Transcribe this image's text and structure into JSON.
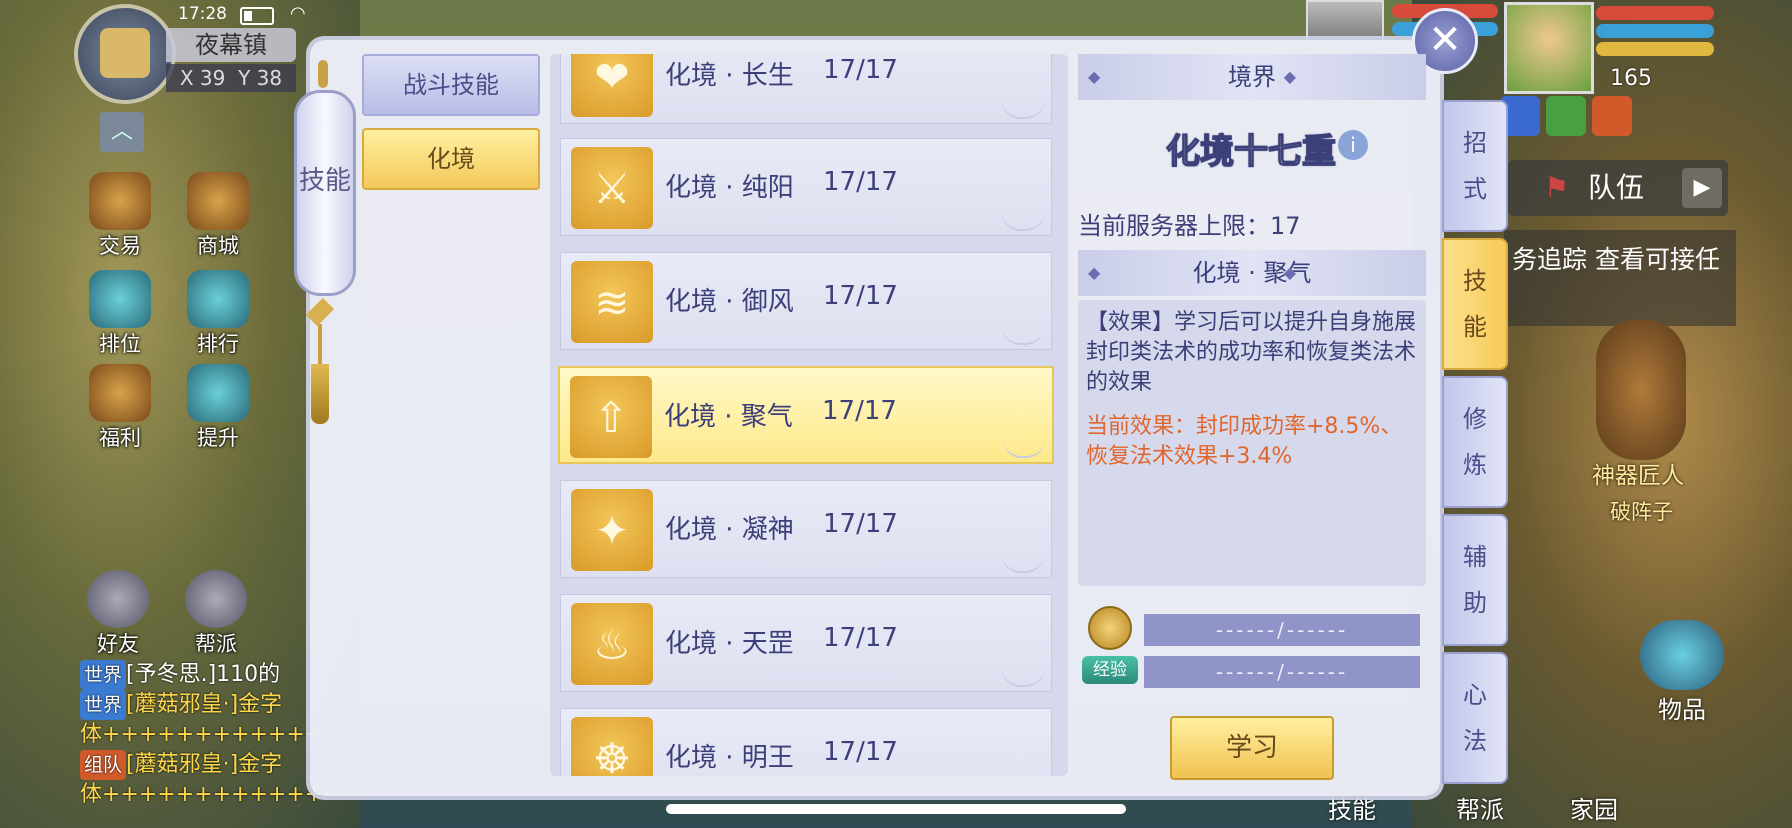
{
  "status": {
    "time": "17:28"
  },
  "map": {
    "town": "夜幕镇",
    "x_label": "X",
    "x": "39",
    "y_label": "Y",
    "y": "38"
  },
  "hud_left": [
    {
      "label": "交易",
      "icon": "trade-icon"
    },
    {
      "label": "商城",
      "icon": "shop-icon"
    },
    {
      "label": "排位",
      "icon": "ranking-icon"
    },
    {
      "label": "排行",
      "icon": "leaderboard-icon"
    },
    {
      "label": "福利",
      "icon": "welfare-icon"
    },
    {
      "label": "提升",
      "icon": "upgrade-icon"
    },
    {
      "label": "好友",
      "icon": "friends-icon"
    },
    {
      "label": "帮派",
      "icon": "guild-icon"
    }
  ],
  "chat": {
    "lines": [
      {
        "tag": "世界",
        "tag_type": "world",
        "text": "[予冬思.]110的"
      },
      {
        "tag": "世界",
        "tag_type": "world",
        "text": "[蘑菇邪皇·]金字"
      },
      {
        "tag": "",
        "tag_type": "",
        "text": "体+++++++++++++++"
      },
      {
        "tag": "组队",
        "tag_type": "team",
        "text": "[蘑菇邪皇·]金字"
      },
      {
        "tag": "",
        "tag_type": "",
        "text": "体+++++++++++++++++[申请入队]"
      }
    ]
  },
  "player": {
    "level": "165"
  },
  "team": {
    "label": "队伍"
  },
  "quest_tip": "务追踪 查看可接任",
  "npc": {
    "name": "神器匠人",
    "title": "破阵子"
  },
  "items": {
    "label": "物品"
  },
  "bottom_menu": [
    "技能",
    "帮派",
    "家园"
  ],
  "panel": {
    "spine_title": "技能",
    "close_label": "✕",
    "side_tabs": [
      {
        "label": "战斗技能",
        "active": false
      },
      {
        "label": "化境",
        "active": true
      }
    ],
    "skills": [
      {
        "name": "化境 · 长生",
        "level": "17/17",
        "icon": "longevity-icon",
        "glyph": "❤",
        "selected": false
      },
      {
        "name": "化境 · 纯阳",
        "level": "17/17",
        "icon": "pure-yang-sword-icon",
        "glyph": "⚔",
        "selected": false
      },
      {
        "name": "化境 · 御风",
        "level": "17/17",
        "icon": "wind-rider-icon",
        "glyph": "≋",
        "selected": false
      },
      {
        "name": "化境 · 聚气",
        "level": "17/17",
        "icon": "gather-qi-icon",
        "glyph": "⇧",
        "selected": true
      },
      {
        "name": "化境 · 凝神",
        "level": "17/17",
        "icon": "focus-spirit-icon",
        "glyph": "✦",
        "selected": false
      },
      {
        "name": "化境 · 天罡",
        "level": "17/17",
        "icon": "heavenly-flame-icon",
        "glyph": "♨",
        "selected": false
      },
      {
        "name": "化境 · 明王",
        "level": "17/17",
        "icon": "wisdom-king-icon",
        "glyph": "☸",
        "selected": false
      }
    ],
    "realm": {
      "header": "境界",
      "title": "化境十七重",
      "info": "i",
      "server_cap": "当前服务器上限：17"
    },
    "detail": {
      "header": "化境 · 聚气",
      "description": "【效果】学习后可以提升自身施展封印类法术的成功率和恢复类法术的效果",
      "current_effect": "当前效果：封印成功率+8.5%、恢复法术效果+3.4%"
    },
    "costs": {
      "coin_value": "------/------",
      "exp_label": "经验",
      "exp_value": "------/------"
    },
    "learn_label": "学习",
    "vertical_tabs": [
      {
        "label": "招式",
        "chars": [
          "招",
          "式"
        ],
        "active": false
      },
      {
        "label": "技能",
        "chars": [
          "技",
          "能"
        ],
        "active": true
      },
      {
        "label": "修炼",
        "chars": [
          "修",
          "炼"
        ],
        "active": false
      },
      {
        "label": "辅助",
        "chars": [
          "辅",
          "助"
        ],
        "active": false
      },
      {
        "label": "心法",
        "chars": [
          "心",
          "法"
        ],
        "active": false
      }
    ]
  },
  "colors": {
    "accent_gold": "#f3c95a",
    "panel_bg": "#eceef7",
    "text_primary": "#3c3f78",
    "effect_orange": "#e0662e"
  }
}
